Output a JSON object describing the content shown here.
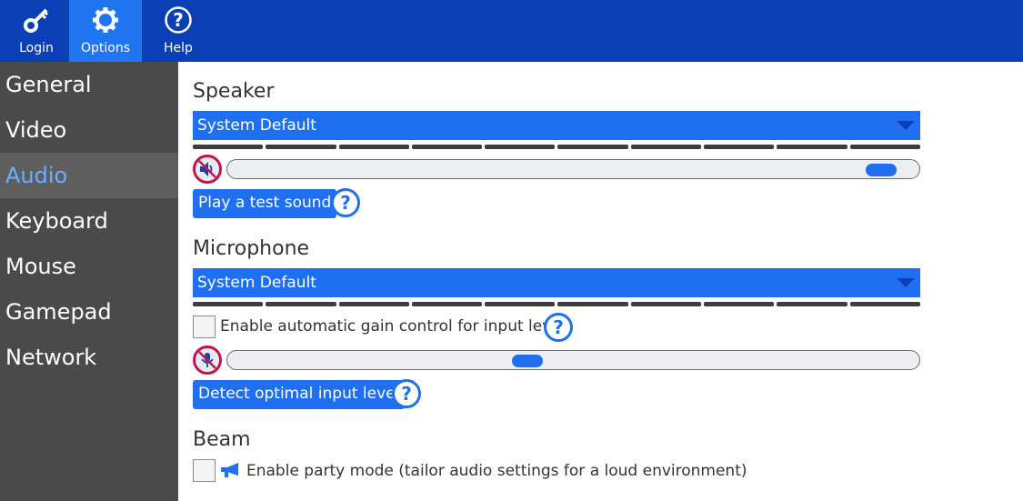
{
  "tabs": [
    {
      "label": "Login",
      "icon": "key-icon"
    },
    {
      "label": "Options",
      "icon": "gear-icon"
    },
    {
      "label": "Help",
      "icon": "help-icon"
    }
  ],
  "sidebar": {
    "items": [
      "General",
      "Video",
      "Audio",
      "Keyboard",
      "Mouse",
      "Gamepad",
      "Network"
    ],
    "active": "Audio"
  },
  "speaker": {
    "title": "Speaker",
    "device": "System Default",
    "volume_level": 0.97,
    "muted": true,
    "test_button": "Play a test sound"
  },
  "microphone": {
    "title": "Microphone",
    "device": "System Default",
    "agc_label": "Enable automatic gain control for input level",
    "agc_checked": false,
    "level": 0.43,
    "muted": true,
    "detect_button": "Detect optimal input level"
  },
  "beam": {
    "title": "Beam",
    "party_label": "Enable party mode (tailor audio settings for a loud environment)",
    "party_checked": false
  },
  "colors": {
    "topbar": "#0a3fb5",
    "accent": "#1f6ff0",
    "sidebar": "#4a4a4a",
    "sidebar_active_text": "#6ab0ff",
    "mute_ring": "#c0144a"
  }
}
